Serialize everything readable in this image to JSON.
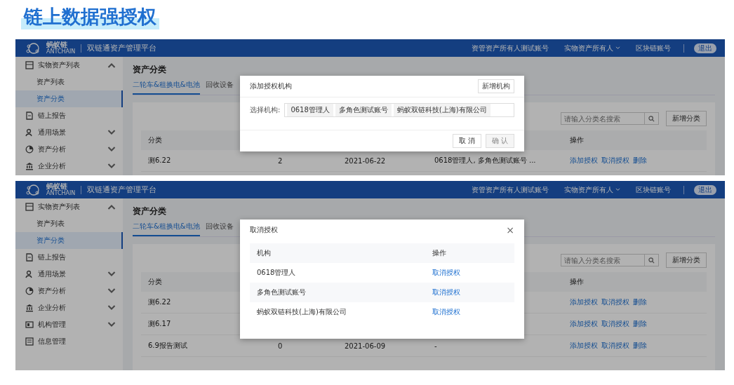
{
  "title": "链上数据强授权",
  "screens": [
    {
      "header": {
        "logo": "蚂蚁链",
        "logo_sub": "ANTCHAIN",
        "app_name": "双链通资产管理平台",
        "account": "资管资产所有人测试账号",
        "role": "实物资产所有人",
        "chain_account": "区块链账号",
        "logout": "退出"
      },
      "sidebar": [
        {
          "label": "实物资产列表",
          "selected": false,
          "expanded": true,
          "children": [
            {
              "label": "资产列表",
              "selected": false
            },
            {
              "label": "资产分类",
              "selected": true
            }
          ]
        },
        {
          "label": "链上报告",
          "selected": false
        },
        {
          "label": "通用场景",
          "selected": false,
          "expanded": false
        },
        {
          "label": "资产分析",
          "selected": false,
          "expanded": false
        },
        {
          "label": "企业分析",
          "selected": false,
          "expanded": false
        }
      ],
      "page_title": "资产分类",
      "tabs": [
        {
          "label": "二轮车&租换电&电池",
          "selected": true
        },
        {
          "label": "回收设备",
          "selected": false
        }
      ],
      "search": {
        "placeholder": "请输入分类名搜索"
      },
      "add_button": "新增分类",
      "table": {
        "category_header": "分类",
        "actions_header": "操作",
        "rows": [
          {
            "category": "测6.22",
            "count": "2",
            "date": "2021-06-22",
            "holders": "0618管理人, 多角色测试账号 ...",
            "actions": [
              "添加授权",
              "取消授权",
              "删除"
            ]
          }
        ]
      },
      "dialog": {
        "kind": "add",
        "title": "添加授权机构",
        "action_button": "新增机构",
        "field_label": "选择机构:",
        "tags": [
          "0618管理人",
          "多角色测试账号",
          "蚂蚁双链科技(上海)有限公司"
        ],
        "buttons": [
          {
            "label": "取 消",
            "disabled": false
          },
          {
            "label": "确 认",
            "disabled": true
          }
        ]
      }
    },
    {
      "header": {
        "logo": "蚂蚁链",
        "logo_sub": "ANTCHAIN",
        "app_name": "双链通资产管理平台",
        "account": "资管资产所有人测试账号",
        "role": "实物资产所有人",
        "chain_account": "区块链账号",
        "logout": "退出"
      },
      "sidebar": [
        {
          "label": "实物资产列表",
          "selected": false,
          "expanded": true,
          "children": [
            {
              "label": "资产列表",
              "selected": false
            },
            {
              "label": "资产分类",
              "selected": true
            }
          ]
        },
        {
          "label": "链上报告",
          "selected": false
        },
        {
          "label": "通用场景",
          "selected": false,
          "expanded": false
        },
        {
          "label": "资产分析",
          "selected": false,
          "expanded": false
        },
        {
          "label": "企业分析",
          "selected": false,
          "expanded": false
        },
        {
          "label": "机构管理",
          "selected": false,
          "expanded": false
        },
        {
          "label": "信息管理",
          "selected": false
        }
      ],
      "page_title": "资产分类",
      "tabs": [
        {
          "label": "二轮车&租换电&电池",
          "selected": true
        },
        {
          "label": "回收设备",
          "selected": false
        }
      ],
      "search": {
        "placeholder": "请输入分类名搜索"
      },
      "add_button": "新增分类",
      "table": {
        "category_header": "分类",
        "actions_header": "操作",
        "rows": [
          {
            "category": "测6.22",
            "actions": [
              "添加授权",
              "取消授权",
              "删除"
            ]
          },
          {
            "category": "测6.17",
            "actions": [
              "添加授权",
              "取消授权",
              "删除"
            ]
          },
          {
            "category": "6.9报告测试",
            "count": "0",
            "date": "2021-06-09",
            "holders": "-",
            "actions": [
              "添加授权",
              "取消授权",
              "删除"
            ]
          }
        ]
      },
      "dialog": {
        "kind": "cancel",
        "title": "取消授权",
        "close": "×",
        "org_header": "机构",
        "action_header": "操作",
        "rows": [
          {
            "org": "0618管理人",
            "action": "取消授权"
          },
          {
            "org": "多角色测试账号",
            "action": "取消授权"
          },
          {
            "org": "蚂蚁双链科技(上海)有限公司",
            "action": "取消授权"
          }
        ]
      }
    }
  ]
}
